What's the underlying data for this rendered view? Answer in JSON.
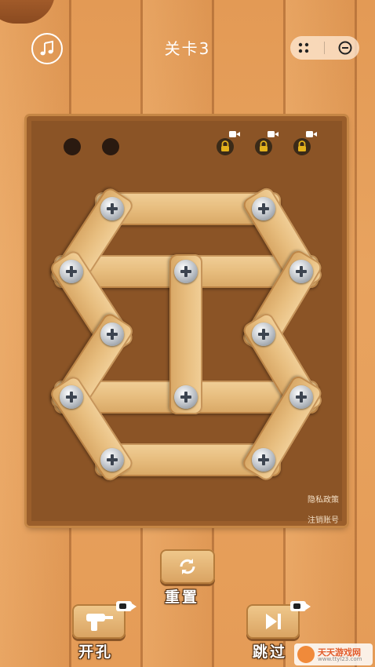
{
  "header": {
    "level_title": "关卡3",
    "music_icon": "music-note-icon",
    "capsule_menu_icon": "more-dots-icon",
    "capsule_close_icon": "minimize-circle-icon"
  },
  "board": {
    "open_holes": 2,
    "locked_slots": 3,
    "locked_slot_icon": "padlock-icon",
    "locked_slot_badge_icon": "video-camera-icon",
    "privacy_policy": "隐私政策",
    "cancel_account": "注销账号"
  },
  "controls": {
    "reset_label": "重置",
    "drill_label": "开孔",
    "skip_label": "跳过"
  },
  "watermark": {
    "name": "天天游戏网",
    "url": "www.ttyl23.com"
  },
  "colors": {
    "board": "#8b5426",
    "plank": "#e7bd7e",
    "screw": "#b9bec4",
    "lock": "#e3b21c"
  }
}
